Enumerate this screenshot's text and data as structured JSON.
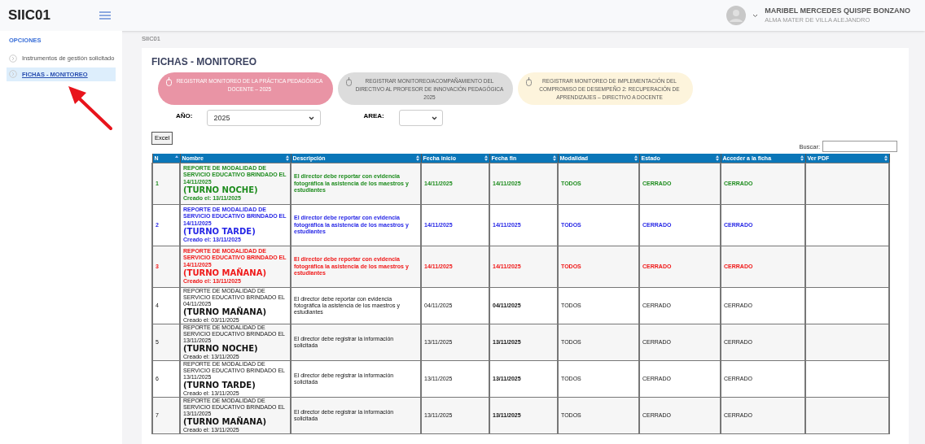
{
  "app": {
    "title": "SIIC01"
  },
  "user": {
    "name": "MARIBEL MERCEDES QUISPE BONZANO",
    "school": "ALMA MATER DE VILLA ALEJANDRO"
  },
  "sidebar": {
    "heading": "OPCIONES",
    "items": [
      {
        "label": "Instrumentos de gestión solicitado",
        "selected": false
      },
      {
        "label": "FICHAS - MONITOREO",
        "selected": true
      }
    ]
  },
  "breadcrumb": "SIIC01",
  "page_title": "FICHAS - MONITOREO",
  "actions": [
    {
      "label": "REGISTRAR MONITOREO DE LA PRÁCTICA PEDAGÓGICA DOCENTE – 2025",
      "color": "#e994a5"
    },
    {
      "label": "REGISTRAR MONITOREO/ACOMPAÑAMIENTO DEL DIRECTIVO AL PROFESOR DE INNOVACIÓN PEDAGÓGICA 2025",
      "color": "#dcdcdc"
    },
    {
      "label": "REGISTRAR MONITOREO DE IMPLEMENTACIÓN DEL COMPROMISO DE DESEMPEÑO 2: RECUPERACIÓN DE APRENDIZAJES – DIRECTIVO A DOCENTE",
      "color": "#fdf4dc"
    }
  ],
  "filters": {
    "year_label": "AÑO:",
    "year_value": "2025",
    "area_label": "AREA:"
  },
  "excel_button": "Excel",
  "search_label": "Buscar:",
  "table": {
    "columns": [
      "N",
      "Nombre",
      "Descripción",
      "Fecha inicio",
      "Fecha fin",
      "Modalidad",
      "Estado",
      "Acceder a la ficha",
      "Ver PDF"
    ],
    "rows": [
      {
        "kind": "highlight",
        "color": "#1e8c1e",
        "n": "1",
        "name": "REPORTE DE MODALIDAD DE SERVICIO EDUCATIVO BRINDADO EL 14/11/2025",
        "shift": "(TURNO NOCHE)",
        "created": "Creado el: 13/11/2025",
        "description": "El director debe reportar con evidencia fotográfica la asistencia de los maestros y estudiantes",
        "start": "14/11/2025",
        "end": "14/11/2025",
        "mode": "TODOS",
        "state": "CERRADO",
        "access": "CERRADO"
      },
      {
        "kind": "highlight",
        "color": "#2727e6",
        "n": "2",
        "name": "REPORTE DE MODALIDAD DE SERVICIO EDUCATIVO BRINDADO EL 14/11/2025",
        "shift": "(TURNO TARDE)",
        "created": "Creado el: 13/11/2025",
        "description": "El director debe reportar con evidencia fotográfica la asistencia de los maestros y estudiantes",
        "start": "14/11/2025",
        "end": "14/11/2025",
        "mode": "TODOS",
        "state": "CERRADO",
        "access": "CERRADO"
      },
      {
        "kind": "highlight",
        "color": "#f01818",
        "n": "3",
        "name": "REPORTE DE MODALIDAD DE SERVICIO EDUCATIVO BRINDADO EL 14/11/2025",
        "shift": "(TURNO MAÑANA)",
        "created": "Creado el: 13/11/2025",
        "description": "El director debe reportar con evidencia fotográfica la asistencia de los maestros y estudiantes",
        "start": "14/11/2025",
        "end": "14/11/2025",
        "mode": "TODOS",
        "state": "CERRADO",
        "access": "CERRADO"
      },
      {
        "kind": "plain",
        "color": "#111111",
        "n": "4",
        "name": "REPORTE DE MODALIDAD DE SERVICIO EDUCATIVO BRINDADO EL 04/11/2025",
        "shift": "(TURNO MAÑANA)",
        "created": "Creado el: 03/11/2025",
        "description": "El director debe reportar con evidencia fotográfica la asistencia de los maestros y estudiantes",
        "start": "04/11/2025",
        "end": "04/11/2025",
        "mode": "TODOS",
        "state": "CERRADO",
        "access": "CERRADO"
      },
      {
        "kind": "plain",
        "color": "#111111",
        "n": "5",
        "name": "REPORTE DE MODALIDAD DE SERVICIO EDUCATIVO BRINDADO EL 13/11/2025",
        "shift": "(TURNO NOCHE)",
        "created": "Creado el: 13/11/2025",
        "description": "El director debe registrar la información solicitada",
        "start": "13/11/2025",
        "end": "13/11/2025",
        "mode": "TODOS",
        "state": "CERRADO",
        "access": "CERRADO"
      },
      {
        "kind": "plain",
        "color": "#111111",
        "n": "6",
        "name": "REPORTE DE MODALIDAD DE SERVICIO EDUCATIVO BRINDADO EL 13/11/2025",
        "shift": "(TURNO TARDE)",
        "created": "Creado el: 13/11/2025",
        "description": "El director debe registrar la información solicitada",
        "start": "13/11/2025",
        "end": "13/11/2025",
        "mode": "TODOS",
        "state": "CERRADO",
        "access": "CERRADO"
      },
      {
        "kind": "plain",
        "color": "#111111",
        "n": "7",
        "name": "REPORTE DE MODALIDAD DE SERVICIO EDUCATIVO BRINDADO EL 13/11/2025",
        "shift": "(TURNO MAÑANA)",
        "created": "Creado el: 13/11/2025",
        "description": "El director debe registrar la información solicitada",
        "start": "13/11/2025",
        "end": "13/11/2025",
        "mode": "TODOS",
        "state": "CERRADO",
        "access": "CERRADO"
      }
    ]
  }
}
